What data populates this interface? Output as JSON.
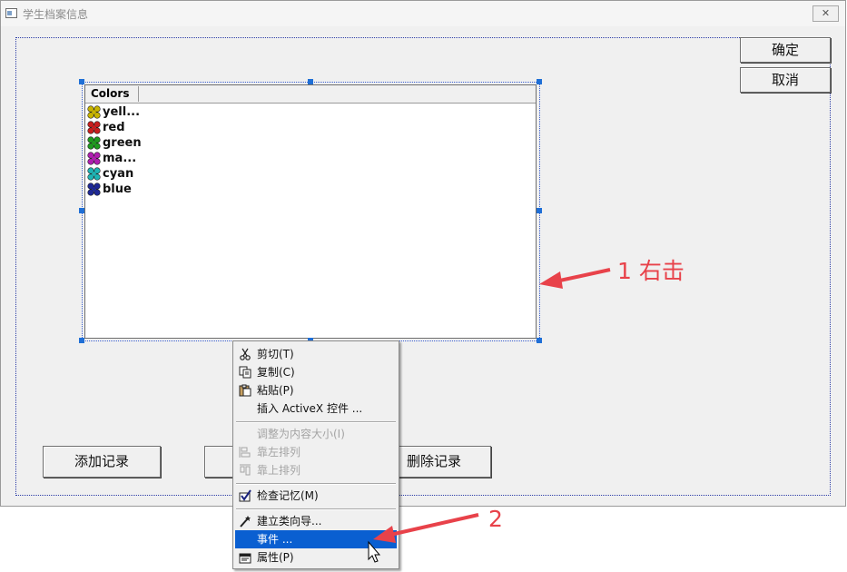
{
  "window": {
    "title": "学生档案信息",
    "close_glyph": "✕"
  },
  "buttons": {
    "ok": "确定",
    "cancel": "取消",
    "add_record": "添加记录",
    "delete_record": "删除记录"
  },
  "listview": {
    "column_header": "Colors",
    "items": [
      {
        "label": "yell...",
        "color": "#c8b400"
      },
      {
        "label": "red",
        "color": "#c81e1e"
      },
      {
        "label": "green",
        "color": "#1e9a1e"
      },
      {
        "label": "ma...",
        "color": "#b01eb0"
      },
      {
        "label": "cyan",
        "color": "#1eb4b4"
      },
      {
        "label": "blue",
        "color": "#1e2896"
      }
    ]
  },
  "context_menu": {
    "items": [
      {
        "label": "剪切(T)",
        "icon": "scissors-icon",
        "enabled": true
      },
      {
        "label": "复制(C)",
        "icon": "copy-icon",
        "enabled": true
      },
      {
        "label": "粘贴(P)",
        "icon": "paste-icon",
        "enabled": true
      },
      {
        "label": "插入 ActiveX 控件   ...",
        "icon": "",
        "enabled": true
      },
      {
        "label": "调整为内容大小(I)",
        "icon": "",
        "enabled": false
      },
      {
        "label": "靠左排列",
        "icon": "align-left-icon",
        "enabled": false
      },
      {
        "label": "靠上排列",
        "icon": "align-top-icon",
        "enabled": false
      },
      {
        "label": "检查记忆(M)",
        "icon": "check-icon",
        "enabled": true
      },
      {
        "label": "建立类向导...",
        "icon": "wizard-icon",
        "enabled": true
      },
      {
        "label": "事件   ...",
        "icon": "",
        "enabled": true,
        "highlighted": true
      },
      {
        "label": "属性(P)",
        "icon": "properties-icon",
        "enabled": true
      }
    ]
  },
  "annotations": {
    "step1": "1 右击",
    "step2": "2",
    "arrow_color": "#e8424a"
  },
  "colors": {
    "selection_blue": "#0a5fd1",
    "handle_blue": "#1f6fd6"
  }
}
